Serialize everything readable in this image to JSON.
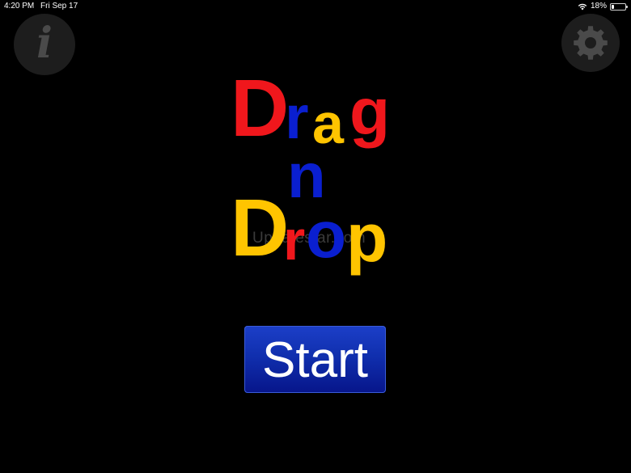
{
  "status_bar": {
    "time": "4:20 PM",
    "date": "Fri Sep 17",
    "battery_percent": "18%",
    "battery_level": 0.18,
    "wifi_icon": "wifi-icon",
    "battery_icon": "battery-icon"
  },
  "toolbar": {
    "info_icon": "info-icon",
    "info_glyph": "i",
    "settings_icon": "gear-icon"
  },
  "logo": {
    "word1": "Drag",
    "word2": "n",
    "word3": "Drop",
    "colors": {
      "red": "#f0171c",
      "blue": "#0a1fd0",
      "yellow": "#ffc400"
    }
  },
  "watermark": "Updatestar.com",
  "start_button": {
    "label": "Start",
    "color": "#102fae"
  }
}
